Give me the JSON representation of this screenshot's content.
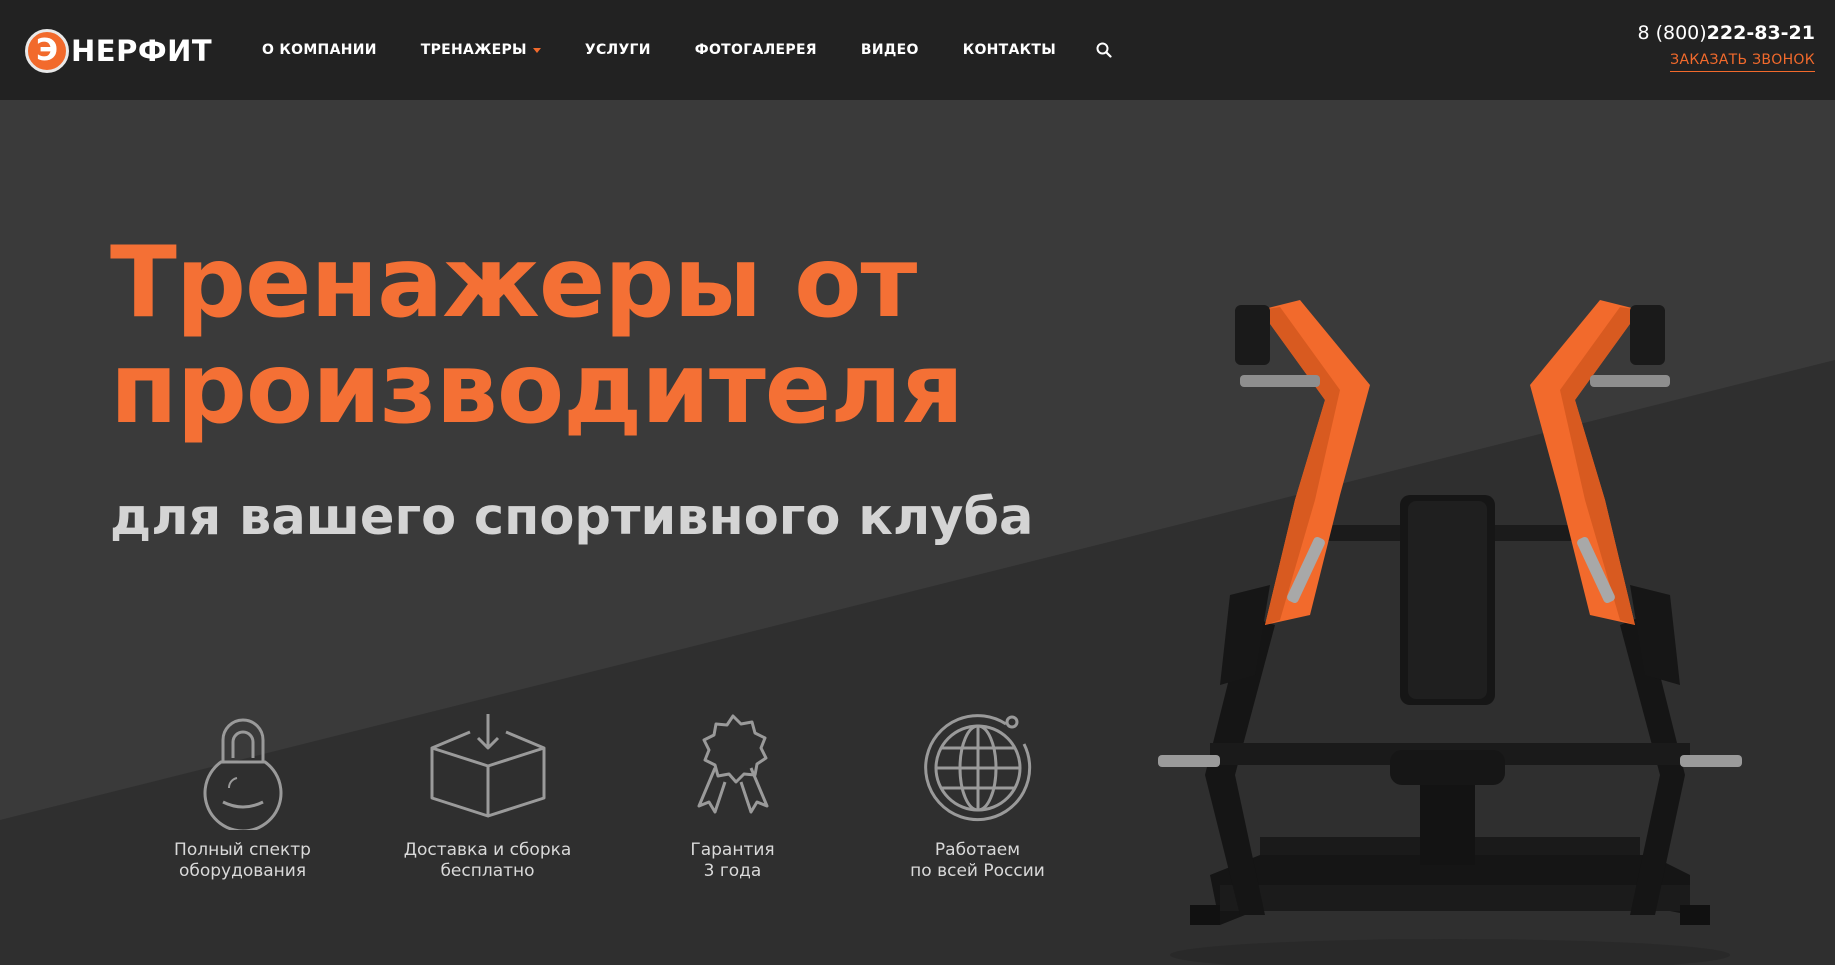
{
  "brand": {
    "logo_letter": "Э",
    "logo_text": "НЕРФИТ",
    "accent_color": "#f26a2c"
  },
  "nav": {
    "items": [
      {
        "label": "О КОМПАНИИ"
      },
      {
        "label": "ТРЕНАЖЕРЫ",
        "has_dropdown": true
      },
      {
        "label": "УСЛУГИ"
      },
      {
        "label": "ФОТОГАЛЕРЕЯ"
      },
      {
        "label": "ВИДЕО"
      },
      {
        "label": "КОНТАКТЫ"
      }
    ],
    "search_icon": "search-icon"
  },
  "contact": {
    "phone_prefix": "8 (800)",
    "phone_number": "222-83-21",
    "callback_label": "ЗАКАЗАТЬ ЗВОНОК"
  },
  "hero": {
    "headline_line1": "Тренажеры от",
    "headline_line2": "производителя",
    "subheadline": "для вашего спортивного клуба"
  },
  "features": [
    {
      "icon": "kettlebell-icon",
      "label": "Полный спектр\nоборудования"
    },
    {
      "icon": "box-delivery-icon",
      "label": "Доставка и сборка\nбесплатно"
    },
    {
      "icon": "award-ribbon-icon",
      "label": "Гарантия\n3 года"
    },
    {
      "icon": "globe-icon",
      "label": "Работаем\nпо всей России"
    }
  ]
}
